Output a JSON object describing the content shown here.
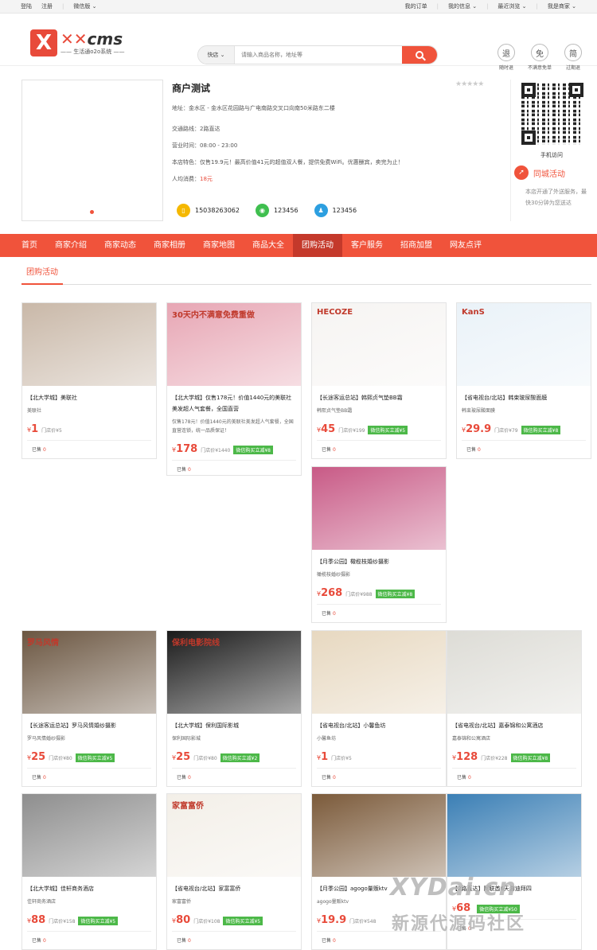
{
  "topbar": {
    "login": "登陆",
    "register": "注册",
    "wechat": "微信版",
    "orders": "我的订单",
    "my_info": "我的信息",
    "recent": "最近浏览",
    "merchant": "我是商家"
  },
  "logo": {
    "brand": "cms",
    "slogan": "生活通o2o系统"
  },
  "search": {
    "type": "快店",
    "placeholder": "请输入商品名称，地址等"
  },
  "promises": [
    {
      "glyph": "退",
      "label": "随时退"
    },
    {
      "glyph": "免",
      "label": "不满意免单"
    },
    {
      "glyph": "简",
      "label": "过期退"
    }
  ],
  "shop": {
    "name": "商户测试",
    "address": "地址：金水区 - 金水区花园路与广电南路交叉口向南50米路东二楼",
    "route": "交通路线：2路直达",
    "hours": "营业时间：08:00 - 23:00",
    "feature": "本店特色：仅售19.9元！最高价值41元的超值双人餐，提供免费WiFi。优惠酬宾，卖完为止！",
    "avg_label": "人均消费：",
    "avg_price": "18元",
    "phone": "15038263062",
    "wechat": "123456",
    "qq": "123456"
  },
  "side": {
    "mobile": "手机访问",
    "city_title": "同城活动",
    "city_desc": "本店开通了外送服务，最快30分钟为您送达"
  },
  "nav": [
    "首页",
    "商家介绍",
    "商家动态",
    "商家相册",
    "商家地图",
    "商品大全",
    "团购活动",
    "客户服务",
    "招商加盟",
    "网友点评"
  ],
  "tab": "团购活动",
  "cards": [
    {
      "title": "【北大学城】美联社",
      "sub": "美联社",
      "price": "1",
      "orig": "门店价¥5",
      "wx": "",
      "sold_label": "已售",
      "sold": "0"
    },
    {
      "title": "【北大学城】仅售178元！价值1440元的美联社美发超人气套餐，全国直营",
      "sub": "仅售178元！价值1440元的美联社美发超人气套餐，全国直营连锁，统一品质保证！",
      "price": "178",
      "orig": "门店价¥1440",
      "wx": "微信购买立减¥8",
      "sold_label": "已售",
      "sold": "0"
    },
    {
      "title": "【长途客运总站】韩熙贞气垫BB霜",
      "sub": "韩熙贞气垫BB霜",
      "price": "45",
      "orig": "门店价¥199",
      "wx": "微信购买立减¥5",
      "sold_label": "已售",
      "sold": "0"
    },
    {
      "title": "【省电视台/北站】韩束玻尿酸面膜",
      "sub": "韩束玻尿酸面膜",
      "price": "29.9",
      "orig": "门店价¥79",
      "wx": "微信购买立减¥8",
      "sold_label": "已售",
      "sold": "0"
    },
    {
      "title": "【月季公园】橄榄枝婚纱摄影",
      "sub": "橄榄枝婚纱摄影",
      "price": "268",
      "orig": "门店价¥988",
      "wx": "微信购买立减¥8",
      "sold_label": "已售",
      "sold": "0"
    },
    {
      "title": "【长途客运总站】罗马风情婚纱摄影",
      "sub": "罗马风情婚纱摄影",
      "price": "25",
      "orig": "门店价¥80",
      "wx": "微信购买立减¥5",
      "sold_label": "已售",
      "sold": "0"
    },
    {
      "title": "【北大学城】保利国际影城",
      "sub": "保利国际影城",
      "price": "25",
      "orig": "门店价¥80",
      "wx": "微信购买立减¥2",
      "sold_label": "已售",
      "sold": "0"
    },
    {
      "title": "【省电视台/北站】小馨鱼坊",
      "sub": "小馨鱼坊",
      "price": "1",
      "orig": "门店价¥5",
      "wx": "",
      "sold_label": "已售",
      "sold": "0"
    },
    {
      "title": "【省电视台/北站】嘉泰锦和公寓酒店",
      "sub": "嘉泰锦和公寓酒店",
      "price": "128",
      "orig": "门店价¥228",
      "wx": "微信购买立减¥8",
      "sold_label": "已售",
      "sold": "0"
    },
    {
      "title": "【北大学城】佳轩商务酒店",
      "sub": "佳轩商务酒店",
      "price": "88",
      "orig": "门店价¥158",
      "wx": "微信购买立减¥5",
      "sold_label": "已售",
      "sold": "0"
    },
    {
      "title": "【省电视台/北站】家富富侨",
      "sub": "家富富侨",
      "price": "80",
      "orig": "门店价¥108",
      "wx": "微信购买立减¥5",
      "sold_label": "已售",
      "sold": "0"
    },
    {
      "title": "【月季公园】agogo量贩ktv",
      "sub": "agogo量贩ktv",
      "price": "19.9",
      "orig": "门店价¥548",
      "wx": "",
      "sold_label": "已售",
      "sold": "0"
    },
    {
      "title": "【2路直达】阿联酋6天游迪拜四",
      "sub": "",
      "price": "68",
      "orig": "",
      "wx": "微信购买立减¥50",
      "sold_label": "已售",
      "sold": "0"
    }
  ],
  "card_images": [
    {
      "banner": "",
      "bg": "#c9b8a8"
    },
    {
      "banner": "30天内不满意免费重做",
      "bg": "#e7a6b4"
    },
    {
      "banner": "HECOZE",
      "bg": "#f6f4f2"
    },
    {
      "banner": "KanS",
      "bg": "#eaf2f8"
    },
    {
      "banner": "",
      "bg": "#c85a86"
    },
    {
      "banner": "罗马风情",
      "bg": "#6b5641"
    },
    {
      "banner": "保利电影院线",
      "bg": "#1a1a1a"
    },
    {
      "banner": "",
      "bg": "#e7d8c0"
    },
    {
      "banner": "",
      "bg": "#dddcd6"
    },
    {
      "banner": "",
      "bg": "#8e8e8e"
    },
    {
      "banner": "家富富侨",
      "bg": "#f3efe8"
    },
    {
      "banner": "",
      "bg": "#7b5a3a"
    },
    {
      "banner": "",
      "bg": "#3b7fb5"
    }
  ],
  "currency": "¥",
  "watermark": {
    "line1": "XYDai.cn",
    "line2": "新源代源码社区"
  },
  "colors": {
    "accent": "#f0533b",
    "nav_active": "#c4392b",
    "price": "#e84a3a",
    "wechat_green": "#4cb848"
  }
}
